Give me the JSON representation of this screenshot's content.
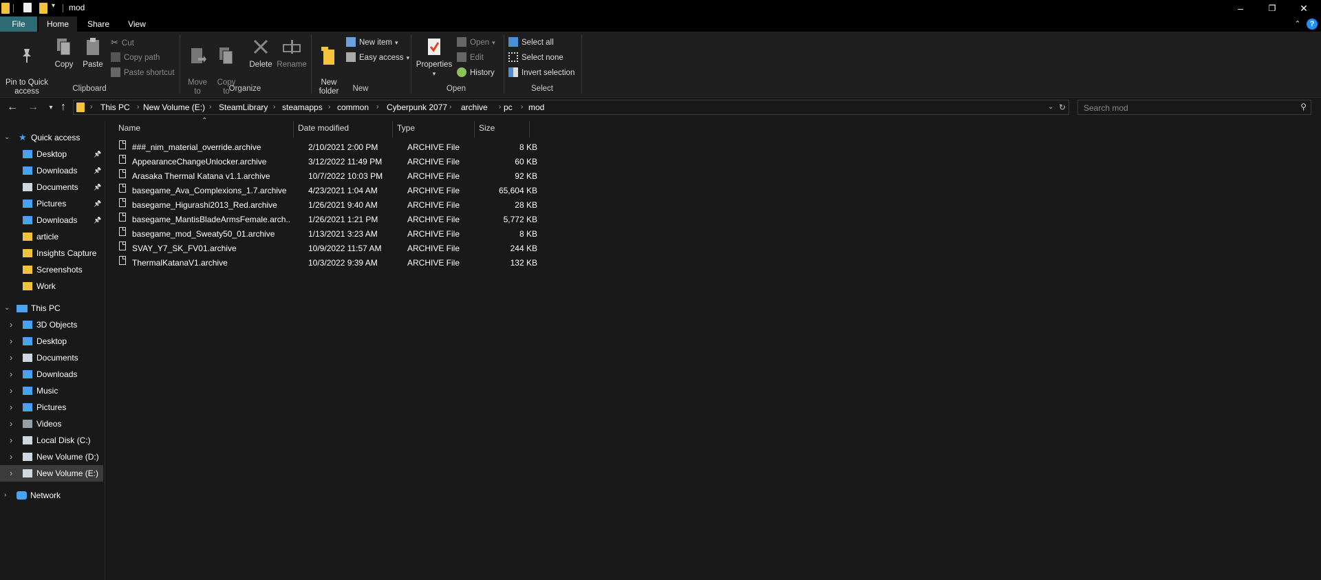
{
  "window": {
    "title": "mod",
    "controls": {
      "minimize": "–",
      "restore": "❐",
      "close": "✕"
    }
  },
  "tabs": {
    "file": "File",
    "home": "Home",
    "share": "Share",
    "view": "View",
    "help": "?"
  },
  "ribbon": {
    "clipboard": {
      "pin_quick_access": "Pin to Quick\naccess",
      "copy": "Copy",
      "paste": "Paste",
      "cut": "Cut",
      "copy_path": "Copy path",
      "paste_shortcut": "Paste shortcut",
      "label": "Clipboard"
    },
    "organize": {
      "move_to": "Move\nto",
      "copy_to": "Copy\nto",
      "delete": "Delete",
      "rename": "Rename",
      "label": "Organize"
    },
    "new": {
      "new_folder": "New\nfolder",
      "new_item": "New item",
      "easy_access": "Easy access",
      "label": "New"
    },
    "open": {
      "properties": "Properties",
      "open": "Open",
      "edit": "Edit",
      "history": "History",
      "label": "Open"
    },
    "select": {
      "select_all": "Select all",
      "select_none": "Select none",
      "invert_selection": "Invert selection",
      "label": "Select"
    }
  },
  "address": {
    "crumbs": [
      "This PC",
      "New Volume (E:)",
      "SteamLibrary",
      "steamapps",
      "common",
      "Cyberpunk 2077",
      "archive",
      "pc",
      "mod"
    ]
  },
  "search": {
    "placeholder": "Search mod"
  },
  "nav": {
    "quick_access": "Quick access",
    "quick_items": [
      {
        "label": "Desktop",
        "pinned": true
      },
      {
        "label": "Downloads",
        "pinned": true
      },
      {
        "label": "Documents",
        "pinned": true
      },
      {
        "label": "Pictures",
        "pinned": true
      },
      {
        "label": "Downloads",
        "pinned": true
      },
      {
        "label": "article",
        "pinned": false
      },
      {
        "label": "Insights Capture",
        "pinned": false
      },
      {
        "label": "Screenshots",
        "pinned": false
      },
      {
        "label": "Work",
        "pinned": false
      }
    ],
    "this_pc": "This PC",
    "pc_items": [
      "3D Objects",
      "Desktop",
      "Documents",
      "Downloads",
      "Music",
      "Pictures",
      "Videos",
      "Local Disk (C:)",
      "New Volume (D:)",
      "New Volume (E:)"
    ],
    "network": "Network",
    "colors": {
      "folder": "#f4c33d",
      "selected_bg": "#3b3b3b",
      "accent": "#1e90ff"
    }
  },
  "files": {
    "columns": {
      "name": "Name",
      "date": "Date modified",
      "type": "Type",
      "size": "Size"
    },
    "rows": [
      {
        "name": "###_nim_material_override.archive",
        "date": "2/10/2021 2:00 PM",
        "type": "ARCHIVE File",
        "size": "8 KB"
      },
      {
        "name": "AppearanceChangeUnlocker.archive",
        "date": "3/12/2022 11:49 PM",
        "type": "ARCHIVE File",
        "size": "60 KB"
      },
      {
        "name": "Arasaka Thermal Katana v1.1.archive",
        "date": "10/7/2022 10:03 PM",
        "type": "ARCHIVE File",
        "size": "92 KB"
      },
      {
        "name": "basegame_Ava_Complexions_1.7.archive",
        "date": "4/23/2021 1:04 AM",
        "type": "ARCHIVE File",
        "size": "65,604 KB"
      },
      {
        "name": "basegame_Higurashi2013_Red.archive",
        "date": "1/26/2021 9:40 AM",
        "type": "ARCHIVE File",
        "size": "28 KB"
      },
      {
        "name": "basegame_MantisBladeArmsFemale.arch...",
        "date": "1/26/2021 1:21 PM",
        "type": "ARCHIVE File",
        "size": "5,772 KB"
      },
      {
        "name": "basegame_mod_Sweaty50_01.archive",
        "date": "1/13/2021 3:23 AM",
        "type": "ARCHIVE File",
        "size": "8 KB"
      },
      {
        "name": "SVAY_Y7_SK_FV01.archive",
        "date": "10/9/2022 11:57 AM",
        "type": "ARCHIVE File",
        "size": "244 KB"
      },
      {
        "name": "ThermalKatanaV1.archive",
        "date": "10/3/2022 9:39 AM",
        "type": "ARCHIVE File",
        "size": "132 KB"
      }
    ]
  }
}
